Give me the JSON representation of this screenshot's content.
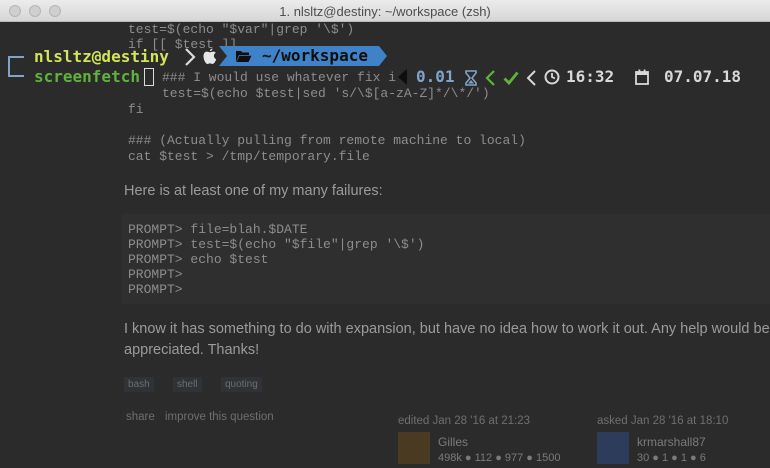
{
  "window": {
    "title": "1. nlsltz@destiny: ~/workspace (zsh)"
  },
  "page": {
    "code_top": "test=$(echo \"$var\"|grep '\\$')\nif [[ $test ]]",
    "code_mid_comment": "### I would use whatever fix i",
    "code_mid_line2": "test=$(echo $test|sed 's/\\$[a-zA-Z]*/\\*/')",
    "code_fi": "fi",
    "code_pull_comment": "### (Actually pulling from remote machine to local)",
    "code_cat": "cat $test > /tmp/temporary.file",
    "failure_intro": "Here is at least one of my many failures:",
    "failure_code": "PROMPT> file=blah.$DATE\nPROMPT> test=$(echo \"$file\"|grep '\\$')\nPROMPT> echo $test\nPROMPT>\nPROMPT>",
    "expansion_text": "I know it has something to do with expansion, but have no idea how to work it out. Any help would be appreciated. Thanks!",
    "tags": [
      "bash",
      "shell",
      "quoting"
    ],
    "share_link": "share",
    "improve_link": "improve this question",
    "edited_meta": "edited Jan 28 '16 at 21:23",
    "asked_meta": "asked Jan 28 '16 at 18:10",
    "editor": {
      "name": "Gilles",
      "stats": "498k ● 112 ● 977 ● 1500"
    },
    "asker": {
      "name": "krmarshall87",
      "stats": "30 ● 1 ● 1 ● 6"
    }
  },
  "prompt": {
    "user_host": "nlsltz@destiny",
    "os_icon": "apple-icon",
    "folder_icon": "folder-open-icon",
    "path": "~/workspace",
    "command": "screenfetch",
    "exec_time": "0.01",
    "hourglass_icon": "hourglass-icon",
    "status_icon": "check-icon",
    "clock_icon": "clock-icon",
    "time": "16:32",
    "calendar_icon": "calendar-icon",
    "date": "07.07.18",
    "colors": {
      "user": "#d4e45a",
      "path_bg": "#3f82c7",
      "accent": "#7fa4c8",
      "ok": "#5fb33b",
      "right_text": "#d8d8d8"
    }
  }
}
